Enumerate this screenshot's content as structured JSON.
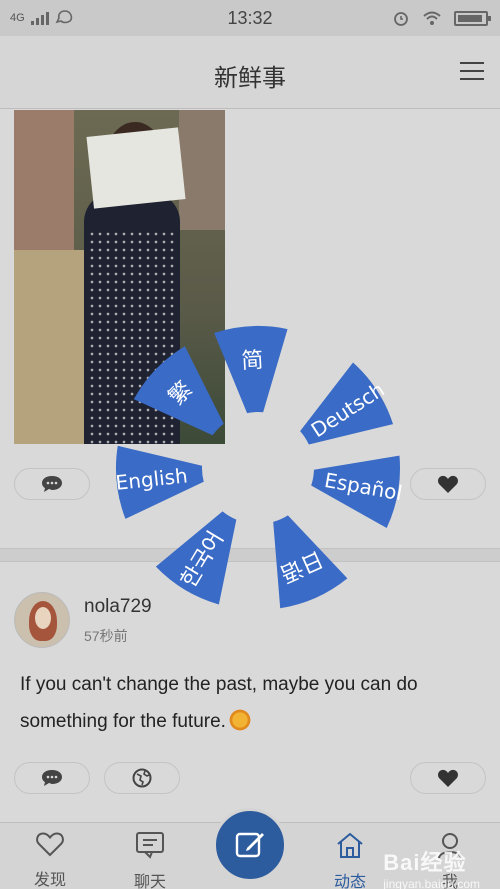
{
  "status_bar": {
    "network": "4G",
    "time": "13:32"
  },
  "header": {
    "title": "新鲜事"
  },
  "post2": {
    "username": "nola729",
    "time_ago": "57秒前",
    "text": "If you can't change the past, maybe you can do something for the future."
  },
  "language_wheel": {
    "options": [
      "简",
      "Deutsch",
      "Español",
      "日语",
      "한국어",
      "English",
      "繁"
    ],
    "segment_color": "#3a6bc6"
  },
  "bottom_nav": {
    "items": [
      {
        "label": "发现",
        "icon": "heart-outline-icon"
      },
      {
        "label": "聊天",
        "icon": "chat-bubble-icon"
      },
      {
        "label": "动态",
        "icon": "house-icon"
      },
      {
        "label": "我",
        "icon": "person-icon"
      }
    ],
    "compose_icon": "compose-icon",
    "accent": "#2c5b9e"
  },
  "watermark": {
    "brand": "Bai经验",
    "domain": "jingyan.baidu.com"
  }
}
